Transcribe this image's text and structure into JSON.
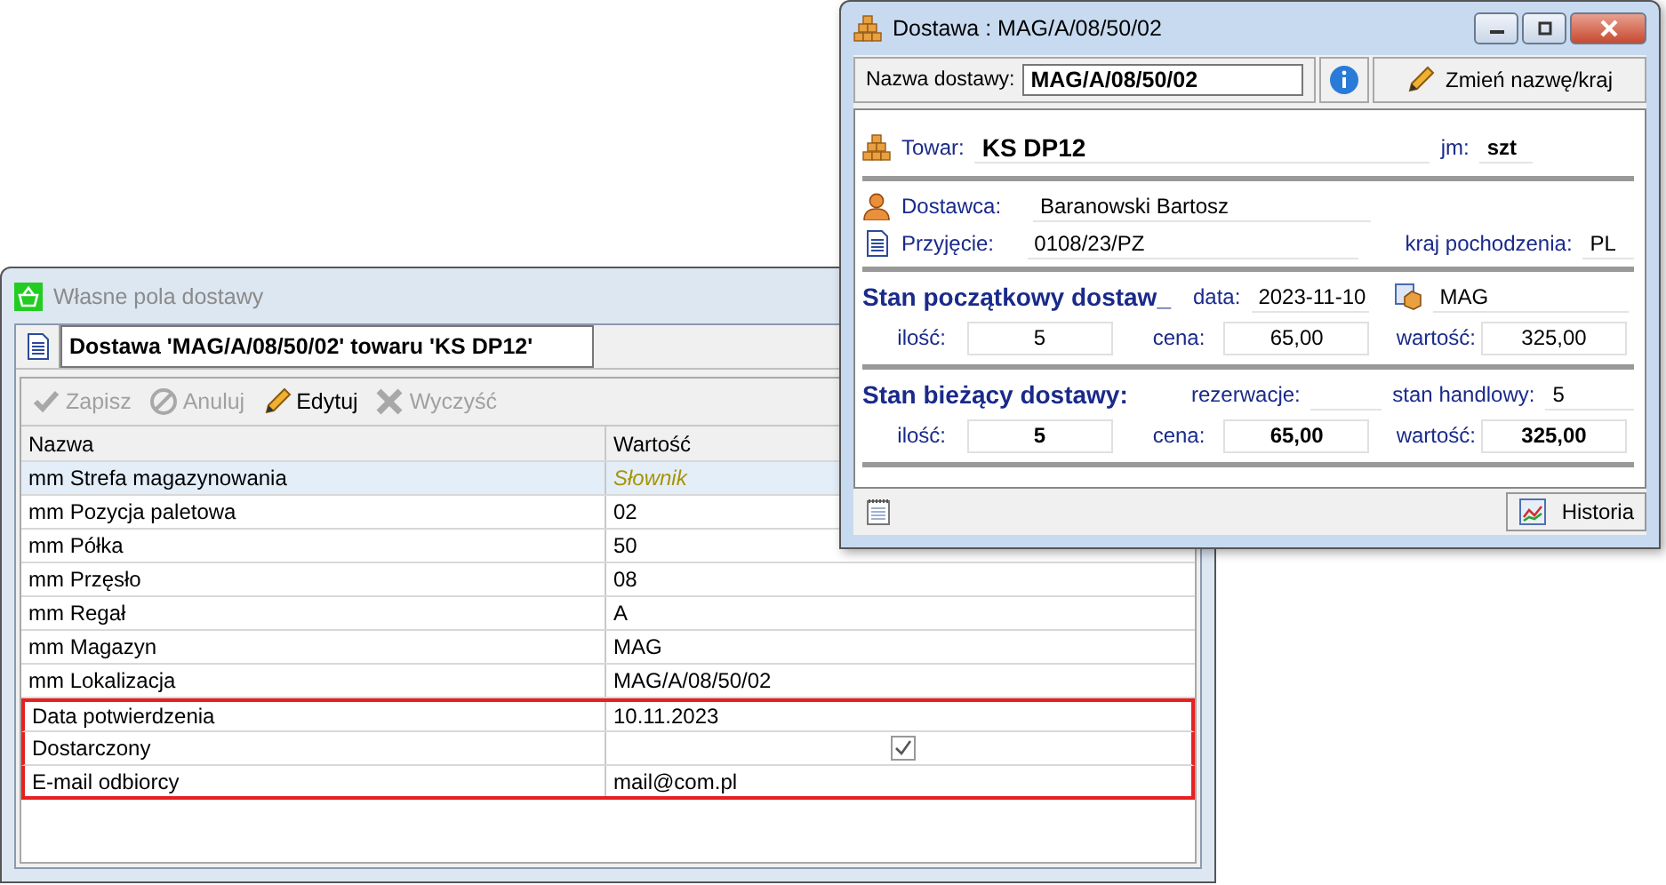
{
  "back_window": {
    "title": "Własne pola dostawy",
    "active": false,
    "header_title": "Dostawa 'MAG/A/08/50/02' towaru 'KS DP12'",
    "toolbar": [
      {
        "kind": "save",
        "label": "Zapisz",
        "disabled": true
      },
      {
        "kind": "cancel",
        "label": "Anuluj",
        "disabled": true
      },
      {
        "kind": "edit",
        "label": "Edytuj",
        "disabled": false
      },
      {
        "kind": "clear",
        "label": "Wyczyść",
        "disabled": true
      }
    ],
    "table": {
      "columns": [
        "Nazwa",
        "Wartość"
      ],
      "rows": [
        {
          "name": "mm Strefa magazynowania",
          "value": "Słownik",
          "kind": "placeholder",
          "selected": true,
          "highlighted": false
        },
        {
          "name": "mm Pozycja paletowa",
          "value": "02",
          "kind": "text",
          "selected": false,
          "highlighted": false
        },
        {
          "name": "mm Półka",
          "value": "50",
          "kind": "text",
          "selected": false,
          "highlighted": false
        },
        {
          "name": "mm Przęsło",
          "value": "08",
          "kind": "text",
          "selected": false,
          "highlighted": false
        },
        {
          "name": "mm Regał",
          "value": "A",
          "kind": "text",
          "selected": false,
          "highlighted": false
        },
        {
          "name": "mm Magazyn",
          "value": "MAG",
          "kind": "text",
          "selected": false,
          "highlighted": false
        },
        {
          "name": "mm Lokalizacja",
          "value": "MAG/A/08/50/02",
          "kind": "text",
          "selected": false,
          "highlighted": false
        },
        {
          "name": "Data potwierdzenia",
          "value": "10.11.2023",
          "kind": "text",
          "selected": false,
          "highlighted": true
        },
        {
          "name": "Dostarczony",
          "kind": "checkbox",
          "checked": true,
          "selected": false,
          "highlighted": true
        },
        {
          "name": "E-mail odbiorcy",
          "value": "mail@com.pl",
          "kind": "text",
          "selected": false,
          "highlighted": true
        }
      ]
    }
  },
  "front_window": {
    "title": "Dostawa : MAG/A/08/50/02",
    "active": true,
    "name_label": "Nazwa dostawy:",
    "name_value": "MAG/A/08/50/02",
    "rename_button": "Zmień nazwę/kraj",
    "towar_label": "Towar:",
    "towar_value": "KS DP12",
    "jm_label": "jm:",
    "jm_value": "szt",
    "dostawca_label": "Dostawca:",
    "dostawca_value": "Baranowski Bartosz",
    "przyjecie_label": "Przyjęcie:",
    "przyjecie_value": "0108/23/PZ",
    "kraj_label": "kraj pochodzenia:",
    "kraj_value": "PL",
    "initial": {
      "title": "Stan początkowy dostaw_",
      "date_label": "data:",
      "date_value": "2023-11-10",
      "warehouse": "MAG",
      "fields": [
        {
          "label": "ilość:",
          "value": "5"
        },
        {
          "label": "cena:",
          "value": "65,00"
        },
        {
          "label": "wartość:",
          "value": "325,00"
        }
      ]
    },
    "current": {
      "title": "Stan bieżący dostawy:",
      "reservations_label": "rezerwacje:",
      "stock_label": "stan handlowy:",
      "stock_value": "5",
      "fields": [
        {
          "label": "ilość:",
          "value": "5"
        },
        {
          "label": "cena:",
          "value": "65,00"
        },
        {
          "label": "wartość:",
          "value": "325,00"
        }
      ]
    },
    "history_button": "Historia"
  }
}
